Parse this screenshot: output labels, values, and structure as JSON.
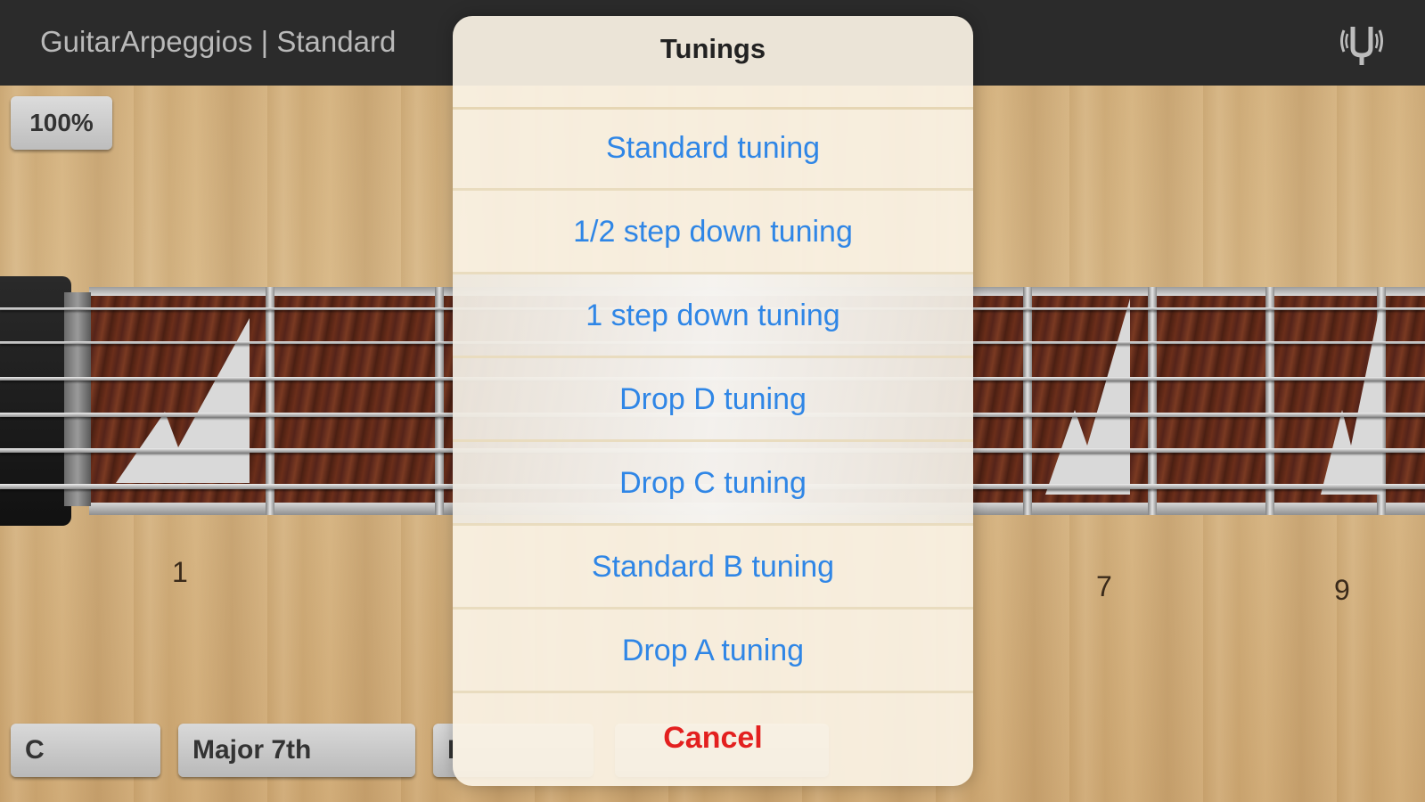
{
  "header": {
    "title": "GuitarArpeggios | Standard"
  },
  "toolbar": {
    "zoom_label": "100%"
  },
  "fretboard": {
    "fret_numbers": [
      "1",
      "7",
      "9"
    ]
  },
  "bottom_bar": {
    "key": "C",
    "chord_type": "Major 7th",
    "third_partial": "I"
  },
  "tuning_sheet": {
    "title": "Tunings",
    "options": [
      "Standard tuning",
      "1/2 step down tuning",
      "1 step down tuning",
      "Drop D tuning",
      "Drop C tuning",
      "Standard B tuning",
      "Drop A tuning"
    ],
    "cancel": "Cancel"
  },
  "colors": {
    "accent": "#2f86e6",
    "destructive": "#e3201f",
    "header_bg": "#2b2b2b"
  },
  "icons": {
    "tuner": "tuning-fork-icon"
  }
}
